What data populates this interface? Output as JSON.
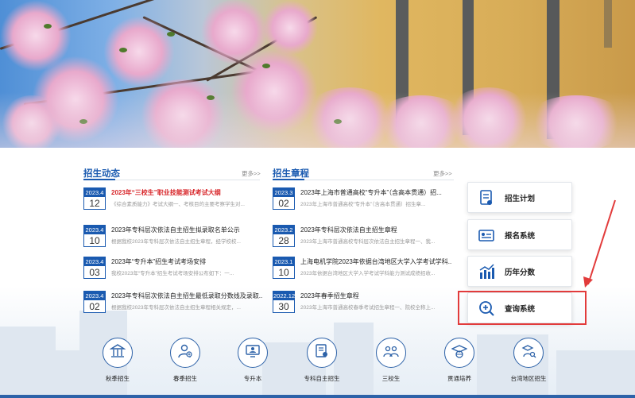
{
  "news": {
    "title": "招生动态",
    "more": "更多>>",
    "items": [
      {
        "ym": "2023.4",
        "day": "12",
        "title": "2023年“三校生”职业技能测试考试大纲",
        "snippet": "《综合素质能力》考试大纲一、考核目的主要考察学生对...",
        "highlight": true
      },
      {
        "ym": "2023.4",
        "day": "10",
        "title": "2023年专科层次依法自主招生拟录取名单公示",
        "snippet": "根据我校2023年专科层次依法自主招生章程，经学校校...",
        "highlight": false
      },
      {
        "ym": "2023.4",
        "day": "03",
        "title": "2023年“专升本”招生考试考场安排",
        "snippet": "我校2023年“专升本”招生考试考场安排公布如下：一...",
        "highlight": false
      },
      {
        "ym": "2023.4",
        "day": "02",
        "title": "2023年专科层次依法自主招生最低录取分数线及录取...",
        "snippet": "根据我校2023年专科层次依法自主招生章程相关规定，...",
        "highlight": false
      }
    ]
  },
  "rules": {
    "title": "招生章程",
    "more": "更多>>",
    "items": [
      {
        "ym": "2023.3",
        "day": "02",
        "title": "2023年上海市普通高校“专升本”（含高本贯通）招...",
        "snippet": "2023年上海市普通高校“专升本”（含高本贯通）招生章..."
      },
      {
        "ym": "2023.2",
        "day": "28",
        "title": "2023年专科层次依法自主招生章程",
        "snippet": "2023年上海市普通高校专科层次依法自主招生章程一、我..."
      },
      {
        "ym": "2023.1",
        "day": "10",
        "title": "上海电机学院2023年依据台湾地区大学入学考试学科...",
        "snippet": "2023年依据台湾地区大学入学考试学科能力测试成绩招收..."
      },
      {
        "ym": "2022.12",
        "day": "30",
        "title": "2023年春季招生章程",
        "snippet": "2023年上海市普通高校春季考试招生章程一、院校全称上..."
      }
    ]
  },
  "quick": [
    {
      "label": "招生计划",
      "icon": "plan-doc-icon"
    },
    {
      "label": "报名系统",
      "icon": "id-card-icon"
    },
    {
      "label": "历年分数",
      "icon": "bar-chart-icon"
    },
    {
      "label": "查询系统",
      "icon": "search-plus-icon"
    }
  ],
  "nav": [
    {
      "label": "秋季招生",
      "icon": "pillar-building-icon"
    },
    {
      "label": "春季招生",
      "icon": "person-plus-icon"
    },
    {
      "label": "专升本",
      "icon": "monitor-user-icon"
    },
    {
      "label": "专科自主招生",
      "icon": "certificate-icon"
    },
    {
      "label": "三校生",
      "icon": "group-users-icon"
    },
    {
      "label": "贯通培养",
      "icon": "graduation-globe-icon"
    },
    {
      "label": "台湾地区招生",
      "icon": "graduate-search-icon"
    }
  ],
  "colors": {
    "primary": "#1a5ab0",
    "highlight": "#d8262a",
    "annotation": "#e23b3b"
  }
}
